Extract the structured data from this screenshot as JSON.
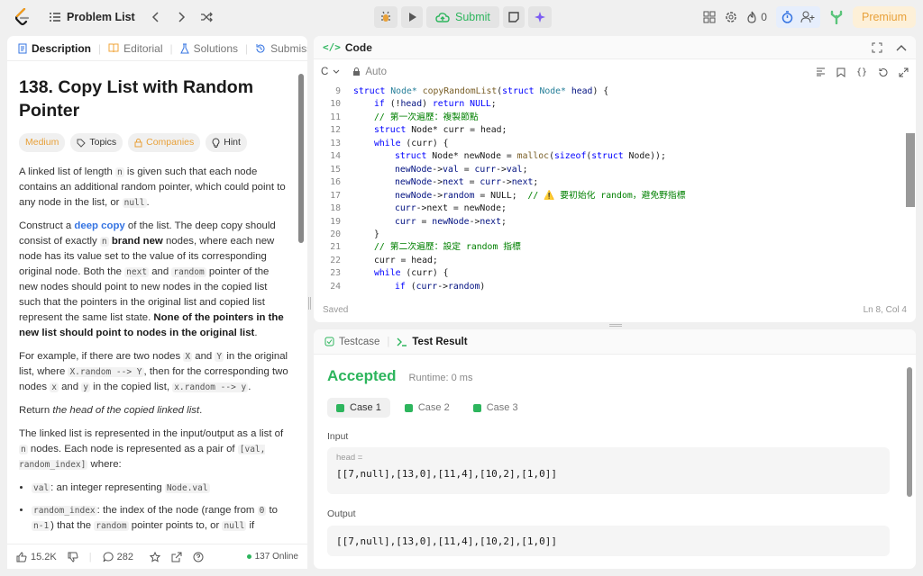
{
  "topbar": {
    "problem_list": "Problem List",
    "submit": "Submit",
    "streak": "0",
    "premium": "Premium"
  },
  "left": {
    "tabs": [
      "Description",
      "Editorial",
      "Solutions",
      "Submissions"
    ],
    "title_l1": "138. Copy List with Random",
    "title_l2": "Pointer",
    "chips": {
      "difficulty": "Medium",
      "topics": "Topics",
      "companies": "Companies",
      "hint": "Hint"
    },
    "p1": {
      "a": "A linked list of length ",
      "c1": "n",
      "b": " is given such that each node contains an additional random pointer, which could point to any node in the list, or ",
      "c2": "null",
      "d": "."
    },
    "p2": {
      "a": "Construct a ",
      "link": "deep copy",
      "b": " of the list. The deep copy should consist of exactly ",
      "c1": "n",
      "bold1": "brand new",
      "c": " nodes, where each new node has its value set to the value of its corresponding original node. Both the ",
      "c2": "next",
      "d": " and ",
      "c3": "random",
      "e": " pointer of the new nodes should point to new nodes in the copied list such that the pointers in the original list and copied list represent the same list state. ",
      "bold2": "None of the pointers in the new list should point to nodes in the original list",
      "f": "."
    },
    "p3": {
      "a": "For example, if there are two nodes ",
      "c1": "X",
      "b": " and ",
      "c2": "Y",
      "c": " in the original list, where ",
      "c3": "X.random --> Y",
      "d": ", then for the corresponding two nodes ",
      "c4": "x",
      "e": " and ",
      "c5": "y",
      "f": " in the copied list, ",
      "c6": "x.random --> y",
      "g": "."
    },
    "p4": {
      "a": "Return ",
      "i": "the head of the copied linked list",
      "b": "."
    },
    "p5": {
      "a": "The linked list is represented in the input/output as a list of ",
      "c1": "n",
      "b": " nodes. Each node is represented as a pair of ",
      "c2": "[val, random_index]",
      "c": " where:"
    },
    "li1": {
      "c1": "val",
      "a": ": an integer representing ",
      "c2": "Node.val"
    },
    "li2": {
      "c1": "random_index",
      "a": ": the index of the node (range from ",
      "c2": "0",
      "b": " to ",
      "c3": "n-1",
      "c": ") that the ",
      "c4": "random",
      "d": " pointer points to, or ",
      "c5": "null",
      "e": " if"
    },
    "footer": {
      "likes": "15.2K",
      "comments": "282",
      "online": "137 Online"
    }
  },
  "code": {
    "title": "Code",
    "lang": "C",
    "mode": "Auto",
    "saved": "Saved",
    "cursor": "Ln 8, Col 4",
    "lines": [
      {
        "n": "9"
      },
      {
        "n": "10"
      },
      {
        "n": "11"
      },
      {
        "n": "12"
      },
      {
        "n": "13"
      },
      {
        "n": "14"
      },
      {
        "n": "15"
      },
      {
        "n": "16"
      },
      {
        "n": "17"
      },
      {
        "n": "18"
      },
      {
        "n": "19"
      },
      {
        "n": "20"
      },
      {
        "n": "21"
      },
      {
        "n": "22"
      },
      {
        "n": "23"
      },
      {
        "n": "24"
      }
    ],
    "text": {
      "l9a": "struct",
      "l9b": " Node* ",
      "l9c": "copyRandomList",
      "l9d": "(",
      "l9e": "struct",
      "l9f": " Node* ",
      "l9g": "head",
      "l9h": ") {",
      "l10a": "if",
      "l10b": " (!",
      "l10c": "head",
      "l10d": ") ",
      "l10e": "return",
      "l10f": " NULL",
      "l11": "// 第一次遍歷：複製節點",
      "l12a": "struct",
      "l12b": " Node* curr = head;",
      "l13a": "while",
      "l13b": " (curr) {",
      "l14a": "struct",
      "l14b": " Node* newNode = ",
      "l14c": "malloc",
      "l14d": "(",
      "l14e": "sizeof",
      "l14f": "(",
      "l14g": "struct",
      "l14h": " Node));",
      "l15a": "newNode",
      "l15b": "->",
      "l15c": "val",
      "l15d": " = ",
      "l15e": "curr",
      "l15f": "->",
      "l15g": "val",
      "l15h": ";",
      "l16a": "newNode",
      "l16b": "->",
      "l16c": "next",
      "l16d": " = ",
      "l16e": "curr",
      "l16f": "->",
      "l16g": "next",
      "l16h": ";",
      "l17a": "newNode",
      "l17b": "->",
      "l17c": "random",
      "l17d": " = NULL;  ",
      "l17e": "// ⚠️ 要初始化 random，避免野指標",
      "l18a": "curr",
      "l18b": "->next = newNode;",
      "l19a": "curr",
      "l19b": " = ",
      "l19c": "newNode",
      "l19d": "->",
      "l19e": "next",
      "l19f": ";",
      "l20": "}",
      "l21": "// 第二次遍歷：設定 random 指標",
      "l22": "curr = head;",
      "l23a": "while",
      "l23b": " (curr) {",
      "l24a": "if",
      "l24b": " (",
      "l24c": "curr",
      "l24d": "->",
      "l24e": "random",
      "l24f": ")"
    }
  },
  "result": {
    "tab_testcase": "Testcase",
    "tab_result": "Test Result",
    "status": "Accepted",
    "runtime": "Runtime: 0 ms",
    "cases": [
      "Case 1",
      "Case 2",
      "Case 3"
    ],
    "input_label": "Input",
    "param": "head =",
    "input_value": "[[7,null],[13,0],[11,4],[10,2],[1,0]]",
    "output_label": "Output",
    "output_value": "[[7,null],[13,0],[11,4],[10,2],[1,0]]"
  }
}
